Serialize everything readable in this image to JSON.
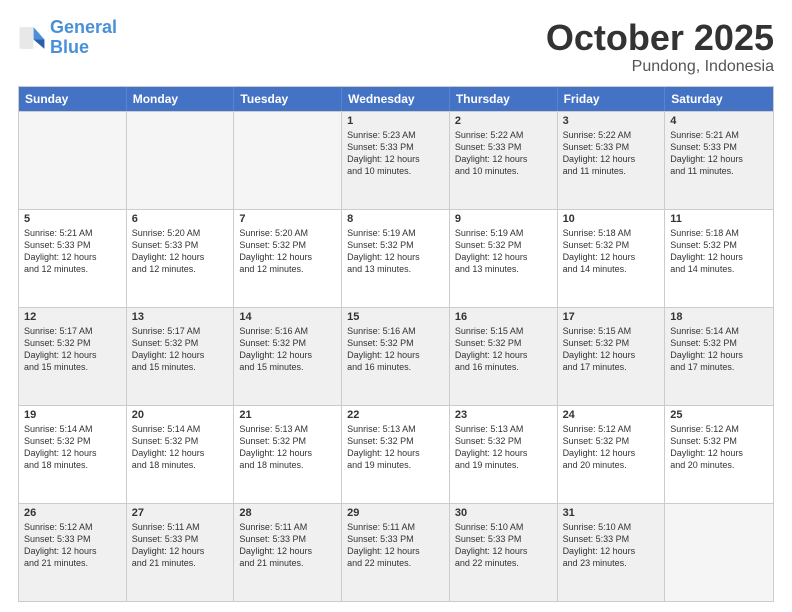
{
  "logo": {
    "line1": "General",
    "line2": "Blue"
  },
  "title": "October 2025",
  "location": "Pundong, Indonesia",
  "weekdays": [
    "Sunday",
    "Monday",
    "Tuesday",
    "Wednesday",
    "Thursday",
    "Friday",
    "Saturday"
  ],
  "rows": [
    [
      {
        "day": "",
        "info": ""
      },
      {
        "day": "",
        "info": ""
      },
      {
        "day": "",
        "info": ""
      },
      {
        "day": "1",
        "info": "Sunrise: 5:23 AM\nSunset: 5:33 PM\nDaylight: 12 hours\nand 10 minutes."
      },
      {
        "day": "2",
        "info": "Sunrise: 5:22 AM\nSunset: 5:33 PM\nDaylight: 12 hours\nand 10 minutes."
      },
      {
        "day": "3",
        "info": "Sunrise: 5:22 AM\nSunset: 5:33 PM\nDaylight: 12 hours\nand 11 minutes."
      },
      {
        "day": "4",
        "info": "Sunrise: 5:21 AM\nSunset: 5:33 PM\nDaylight: 12 hours\nand 11 minutes."
      }
    ],
    [
      {
        "day": "5",
        "info": "Sunrise: 5:21 AM\nSunset: 5:33 PM\nDaylight: 12 hours\nand 12 minutes."
      },
      {
        "day": "6",
        "info": "Sunrise: 5:20 AM\nSunset: 5:33 PM\nDaylight: 12 hours\nand 12 minutes."
      },
      {
        "day": "7",
        "info": "Sunrise: 5:20 AM\nSunset: 5:32 PM\nDaylight: 12 hours\nand 12 minutes."
      },
      {
        "day": "8",
        "info": "Sunrise: 5:19 AM\nSunset: 5:32 PM\nDaylight: 12 hours\nand 13 minutes."
      },
      {
        "day": "9",
        "info": "Sunrise: 5:19 AM\nSunset: 5:32 PM\nDaylight: 12 hours\nand 13 minutes."
      },
      {
        "day": "10",
        "info": "Sunrise: 5:18 AM\nSunset: 5:32 PM\nDaylight: 12 hours\nand 14 minutes."
      },
      {
        "day": "11",
        "info": "Sunrise: 5:18 AM\nSunset: 5:32 PM\nDaylight: 12 hours\nand 14 minutes."
      }
    ],
    [
      {
        "day": "12",
        "info": "Sunrise: 5:17 AM\nSunset: 5:32 PM\nDaylight: 12 hours\nand 15 minutes."
      },
      {
        "day": "13",
        "info": "Sunrise: 5:17 AM\nSunset: 5:32 PM\nDaylight: 12 hours\nand 15 minutes."
      },
      {
        "day": "14",
        "info": "Sunrise: 5:16 AM\nSunset: 5:32 PM\nDaylight: 12 hours\nand 15 minutes."
      },
      {
        "day": "15",
        "info": "Sunrise: 5:16 AM\nSunset: 5:32 PM\nDaylight: 12 hours\nand 16 minutes."
      },
      {
        "day": "16",
        "info": "Sunrise: 5:15 AM\nSunset: 5:32 PM\nDaylight: 12 hours\nand 16 minutes."
      },
      {
        "day": "17",
        "info": "Sunrise: 5:15 AM\nSunset: 5:32 PM\nDaylight: 12 hours\nand 17 minutes."
      },
      {
        "day": "18",
        "info": "Sunrise: 5:14 AM\nSunset: 5:32 PM\nDaylight: 12 hours\nand 17 minutes."
      }
    ],
    [
      {
        "day": "19",
        "info": "Sunrise: 5:14 AM\nSunset: 5:32 PM\nDaylight: 12 hours\nand 18 minutes."
      },
      {
        "day": "20",
        "info": "Sunrise: 5:14 AM\nSunset: 5:32 PM\nDaylight: 12 hours\nand 18 minutes."
      },
      {
        "day": "21",
        "info": "Sunrise: 5:13 AM\nSunset: 5:32 PM\nDaylight: 12 hours\nand 18 minutes."
      },
      {
        "day": "22",
        "info": "Sunrise: 5:13 AM\nSunset: 5:32 PM\nDaylight: 12 hours\nand 19 minutes."
      },
      {
        "day": "23",
        "info": "Sunrise: 5:13 AM\nSunset: 5:32 PM\nDaylight: 12 hours\nand 19 minutes."
      },
      {
        "day": "24",
        "info": "Sunrise: 5:12 AM\nSunset: 5:32 PM\nDaylight: 12 hours\nand 20 minutes."
      },
      {
        "day": "25",
        "info": "Sunrise: 5:12 AM\nSunset: 5:32 PM\nDaylight: 12 hours\nand 20 minutes."
      }
    ],
    [
      {
        "day": "26",
        "info": "Sunrise: 5:12 AM\nSunset: 5:33 PM\nDaylight: 12 hours\nand 21 minutes."
      },
      {
        "day": "27",
        "info": "Sunrise: 5:11 AM\nSunset: 5:33 PM\nDaylight: 12 hours\nand 21 minutes."
      },
      {
        "day": "28",
        "info": "Sunrise: 5:11 AM\nSunset: 5:33 PM\nDaylight: 12 hours\nand 21 minutes."
      },
      {
        "day": "29",
        "info": "Sunrise: 5:11 AM\nSunset: 5:33 PM\nDaylight: 12 hours\nand 22 minutes."
      },
      {
        "day": "30",
        "info": "Sunrise: 5:10 AM\nSunset: 5:33 PM\nDaylight: 12 hours\nand 22 minutes."
      },
      {
        "day": "31",
        "info": "Sunrise: 5:10 AM\nSunset: 5:33 PM\nDaylight: 12 hours\nand 23 minutes."
      },
      {
        "day": "",
        "info": ""
      }
    ]
  ]
}
